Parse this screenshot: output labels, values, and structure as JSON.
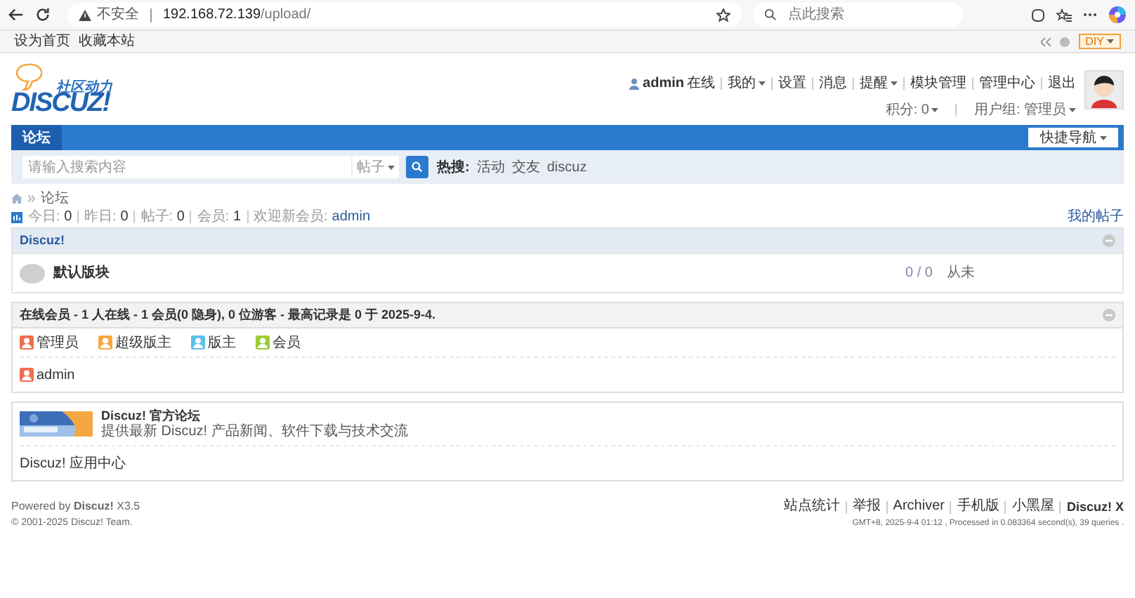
{
  "browser": {
    "security_label": "不安全",
    "url_host": "192.168.72.139",
    "url_path": "/upload/",
    "search_placeholder": "点此搜索"
  },
  "topbar": {
    "links": [
      "设为首页",
      "收藏本站"
    ],
    "diy": "DIY"
  },
  "logo": {
    "tagline": "社区动力",
    "name": "DISCUZ!"
  },
  "user": {
    "name": "admin",
    "status": "在线",
    "links": [
      {
        "label": "我的",
        "dropdown": true
      },
      {
        "label": "设置",
        "dropdown": false
      },
      {
        "label": "消息",
        "dropdown": false
      },
      {
        "label": "提醒",
        "dropdown": true
      },
      {
        "label": "模块管理",
        "dropdown": false
      },
      {
        "label": "管理中心",
        "dropdown": false
      },
      {
        "label": "退出",
        "dropdown": false
      }
    ],
    "credits": [
      {
        "label": "积分: 0",
        "dropdown": true
      },
      {
        "label": "用户组: 管理员",
        "dropdown": true
      }
    ]
  },
  "nav": {
    "items": [
      {
        "label": "论坛",
        "selected": true
      }
    ],
    "quick_nav": "快捷导航"
  },
  "search": {
    "placeholder": "请输入搜索内容",
    "type": "帖子",
    "hot_label": "热搜:",
    "hot": [
      "活动",
      "交友",
      "discuz"
    ]
  },
  "breadcrumb": [
    "论坛"
  ],
  "stats": {
    "items": [
      {
        "label": "今日:",
        "value": "0"
      },
      {
        "label": "昨日:",
        "value": "0"
      },
      {
        "label": "帖子:",
        "value": "0"
      },
      {
        "label": "会员:",
        "value": "1"
      }
    ],
    "welcome": "欢迎新会员:",
    "new_member": "admin",
    "my_posts": "我的帖子"
  },
  "categories": [
    {
      "title": "Discuz!",
      "forums": [
        {
          "name": "默认版块",
          "counts": "0 / 0",
          "last_post": "从未"
        }
      ]
    }
  ],
  "online": {
    "title": "在线会员 - 1 人在线 - 1 会员(0 隐身), 0 位游客 - 最高记录是 0 于 2025-9-4.",
    "legend": [
      {
        "label": "管理员",
        "color": "#f26c4f"
      },
      {
        "label": "超级版主",
        "color": "#f5a742"
      },
      {
        "label": "版主",
        "color": "#5bc0eb"
      },
      {
        "label": "会员",
        "color": "#9acd32"
      }
    ],
    "members": [
      {
        "name": "admin",
        "color": "#f26c4f"
      }
    ]
  },
  "links": {
    "image_links": [
      {
        "title": "Discuz! 官方论坛",
        "description": "提供最新 Discuz! 产品新闻、软件下载与技术交流"
      }
    ],
    "text_links": [
      "Discuz! 应用中心"
    ]
  },
  "footer": {
    "powered": "Powered by **Discuz!** X3.5",
    "copyright": "© 2001-2025 Discuz! Team.",
    "links": [
      "站点统计",
      "举报",
      "Archiver",
      "手机版",
      "小黑屋"
    ],
    "brand": "Discuz! X",
    "info": "GMT+8, 2025-9-4 01:12 , Processed in 0.083364 second(s), 39 queries ."
  }
}
